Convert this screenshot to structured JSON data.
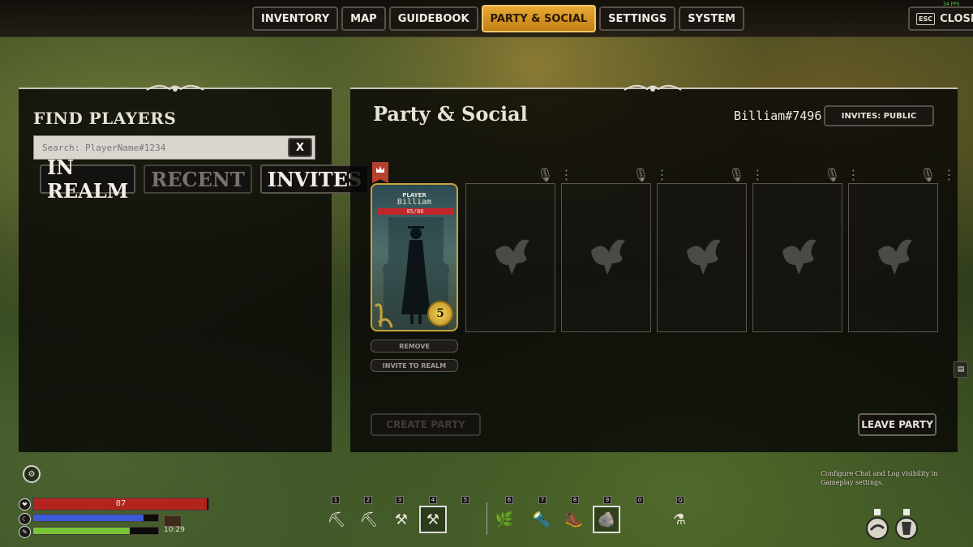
{
  "fps": "34 FPS",
  "nav": {
    "tabs": [
      "INVENTORY",
      "MAP",
      "GUIDEBOOK",
      "PARTY & SOCIAL",
      "SETTINGS",
      "SYSTEM"
    ],
    "active": "PARTY & SOCIAL",
    "esc_key": "ESC",
    "close_label": "CLOSE"
  },
  "find_players": {
    "title": "FIND PLAYERS",
    "search_placeholder": "Search: PlayerName#1234",
    "clear_label": "X",
    "tabs": [
      "IN REALM",
      "RECENT",
      "INVITES"
    ]
  },
  "party": {
    "title": "Party & Social",
    "player_id": "Billiam#7496",
    "invites_label": "INVITES: PUBLIC",
    "card": {
      "role": "PLAYER",
      "name": "Billiam",
      "hp": "85/86",
      "level": "5"
    },
    "remove_label": "REMOVE",
    "invite_label": "INVITE TO REALM",
    "create_label": "CREATE PARTY",
    "leave_label": "LEAVE PARTY"
  },
  "chat_hint": "Configure Chat and Log visibility in Gameplay settings.",
  "hud": {
    "health": "87",
    "health_fraction": 0.99,
    "mana_fraction": 0.88,
    "stamina_fraction": 0.77,
    "time": "10:29"
  },
  "hotbar": {
    "keys": [
      "1",
      "2",
      "3",
      "4",
      "5",
      "6",
      "7",
      "8",
      "9",
      "0",
      "Q"
    ]
  }
}
